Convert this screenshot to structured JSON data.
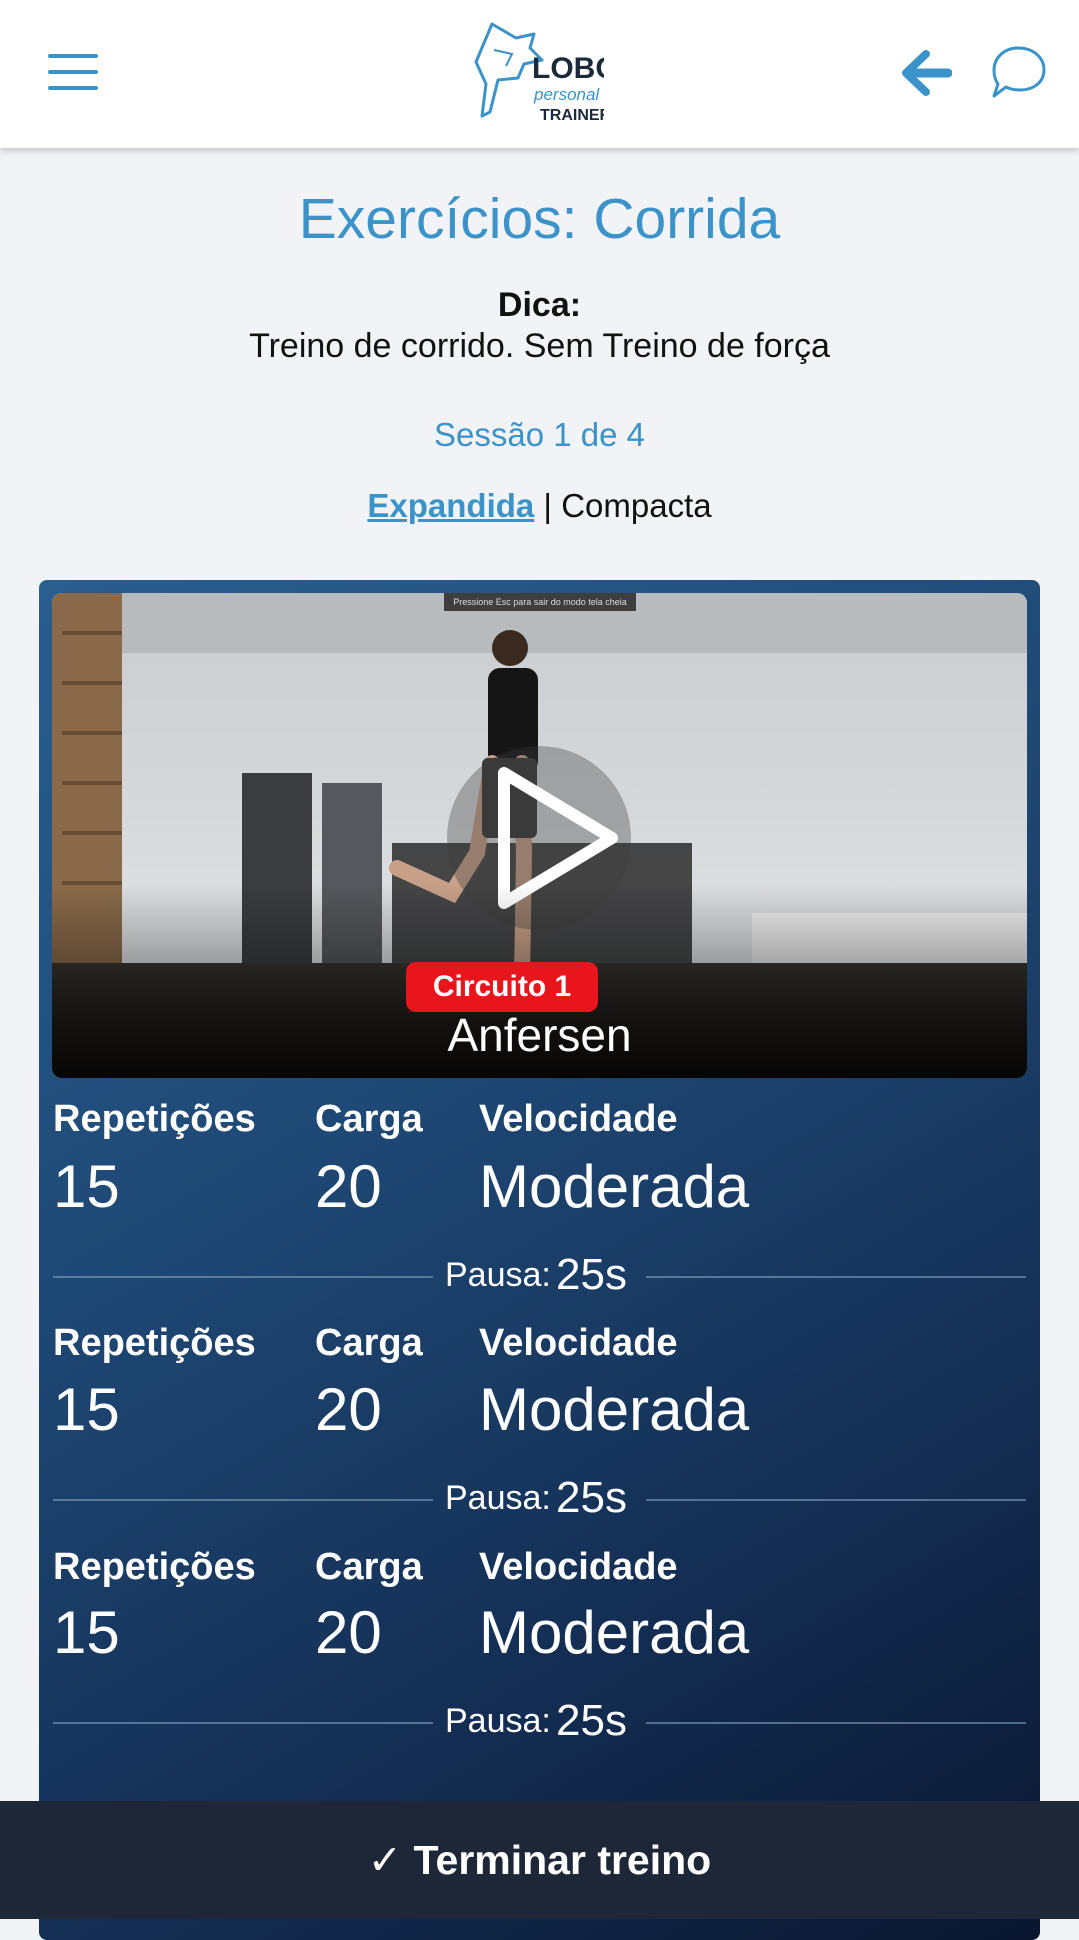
{
  "header": {
    "menu_icon": "hamburger-menu-icon",
    "logo_text_1": "LOBO",
    "logo_text_2": "personal",
    "logo_text_3": "TRAINER",
    "back_icon": "arrow-left-icon",
    "chat_icon": "chat-bubble-icon",
    "accent_color": "#3b93c9"
  },
  "page": {
    "title": "Exercícios: Corrida",
    "tip_label": "Dica:",
    "tip_text": "Treino de corrido. Sem Treino de força",
    "session": "Sessão 1 de 4",
    "view_expanded": "Expandida",
    "view_separator": " | ",
    "view_compact": "Compacta"
  },
  "exercise": {
    "fullscreen_note": "Pressione Esc para sair do modo tela cheia",
    "play_icon": "play-icon",
    "circuit": "Circuito 1",
    "name": "Anfersen",
    "badge_color": "#e8161c",
    "sets": [
      {
        "reps_label": "Repetições",
        "reps": "15",
        "load_label": "Carga",
        "load": "20",
        "speed_label": "Velocidade",
        "speed": "Moderada",
        "pause_label": "Pausa:",
        "pause": "25s"
      },
      {
        "reps_label": "Repetições",
        "reps": "15",
        "load_label": "Carga",
        "load": "20",
        "speed_label": "Velocidade",
        "speed": "Moderada",
        "pause_label": "Pausa:",
        "pause": "25s"
      },
      {
        "reps_label": "Repetições",
        "reps": "15",
        "load_label": "Carga",
        "load": "20",
        "speed_label": "Velocidade",
        "speed": "Moderada",
        "pause_label": "Pausa:",
        "pause": "25s"
      }
    ]
  },
  "footer": {
    "finish_label": "✓ Terminar treino"
  }
}
